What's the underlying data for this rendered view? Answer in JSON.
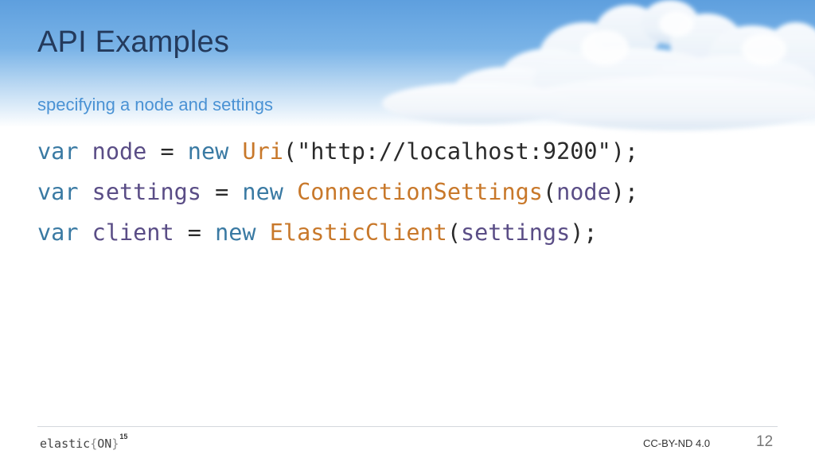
{
  "slide": {
    "title": "API Examples",
    "subtitle": "specifying a node and settings"
  },
  "code": {
    "lines": [
      [
        {
          "text": "var",
          "role": "keyword"
        },
        {
          "text": " ",
          "role": "space"
        },
        {
          "text": "node",
          "role": "identifier"
        },
        {
          "text": " = ",
          "role": "plain"
        },
        {
          "text": "new",
          "role": "keyword"
        },
        {
          "text": " ",
          "role": "space"
        },
        {
          "text": "Uri",
          "role": "type"
        },
        {
          "text": "(\"http://localhost:9200\");",
          "role": "plain"
        }
      ],
      [
        {
          "text": "var",
          "role": "keyword"
        },
        {
          "text": " ",
          "role": "space"
        },
        {
          "text": "settings",
          "role": "identifier"
        },
        {
          "text": " = ",
          "role": "plain"
        },
        {
          "text": "new",
          "role": "keyword"
        },
        {
          "text": " ",
          "role": "space"
        },
        {
          "text": "ConnectionSettings",
          "role": "type"
        },
        {
          "text": "(",
          "role": "plain"
        },
        {
          "text": "node",
          "role": "identifier"
        },
        {
          "text": ");",
          "role": "plain"
        }
      ],
      [
        {
          "text": "var",
          "role": "keyword"
        },
        {
          "text": " ",
          "role": "space"
        },
        {
          "text": "client",
          "role": "identifier"
        },
        {
          "text": " = ",
          "role": "plain"
        },
        {
          "text": "new",
          "role": "keyword"
        },
        {
          "text": " ",
          "role": "space"
        },
        {
          "text": "ElasticClient",
          "role": "type"
        },
        {
          "text": "(",
          "role": "plain"
        },
        {
          "text": "settings",
          "role": "identifier"
        },
        {
          "text": ");",
          "role": "plain"
        }
      ]
    ]
  },
  "footer": {
    "logo": {
      "word": "elastic",
      "open_brace": "{",
      "on": "ON",
      "close_brace": "}",
      "year": "15"
    },
    "license": "CC-BY-ND 4.0",
    "page_number": "12"
  },
  "colors": {
    "title": "#243a5c",
    "subtitle": "#4a92d4",
    "keyword": "#3a7aa3",
    "identifier": "#5a4d86",
    "type": "#c8782a",
    "plain": "#2a2a2a"
  }
}
